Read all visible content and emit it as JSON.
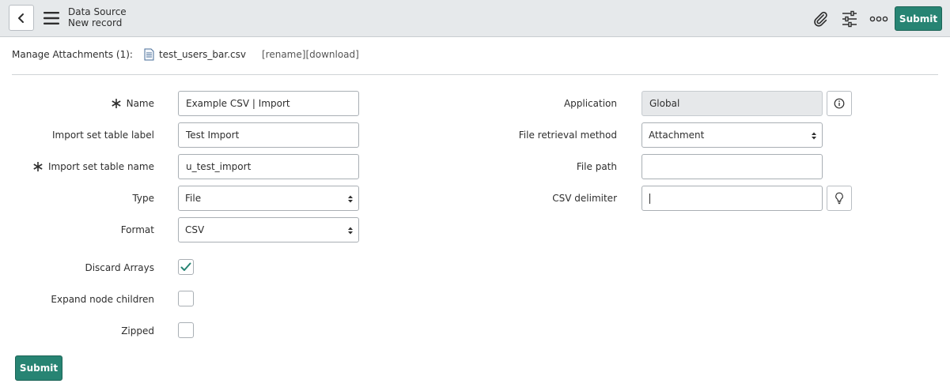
{
  "header": {
    "title": "Data Source",
    "subtitle": "New record",
    "submit_label": "Submit",
    "icons": [
      "chevron-left-icon",
      "hamburger-icon",
      "paperclip-icon",
      "sliders-icon",
      "more-icon"
    ]
  },
  "attachments": {
    "label": "Manage Attachments (1):",
    "file_name": "test_users_bar.csv",
    "rename_label": "[rename]",
    "download_label": "[download]"
  },
  "form": {
    "name": {
      "label": "Name",
      "value": "Example CSV | Import",
      "required": true
    },
    "import_set_table_label": {
      "label": "Import set table label",
      "value": "Test Import"
    },
    "import_set_table_name": {
      "label": "Import set table name",
      "value": "u_test_import",
      "required": true
    },
    "type": {
      "label": "Type",
      "value": "File"
    },
    "format": {
      "label": "Format",
      "value": "CSV"
    },
    "discard_arrays": {
      "label": "Discard Arrays",
      "checked": true
    },
    "expand_node_children": {
      "label": "Expand node children",
      "checked": false
    },
    "zipped": {
      "label": "Zipped",
      "checked": false
    },
    "application": {
      "label": "Application",
      "value": "Global"
    },
    "file_retrieval_method": {
      "label": "File retrieval method",
      "value": "Attachment"
    },
    "file_path": {
      "label": "File path",
      "value": ""
    },
    "csv_delimiter": {
      "label": "CSV delimiter",
      "value": ""
    }
  },
  "footer": {
    "submit_label": "Submit"
  },
  "colors": {
    "accent": "#278473",
    "header_bg": "#e6e9eb"
  }
}
